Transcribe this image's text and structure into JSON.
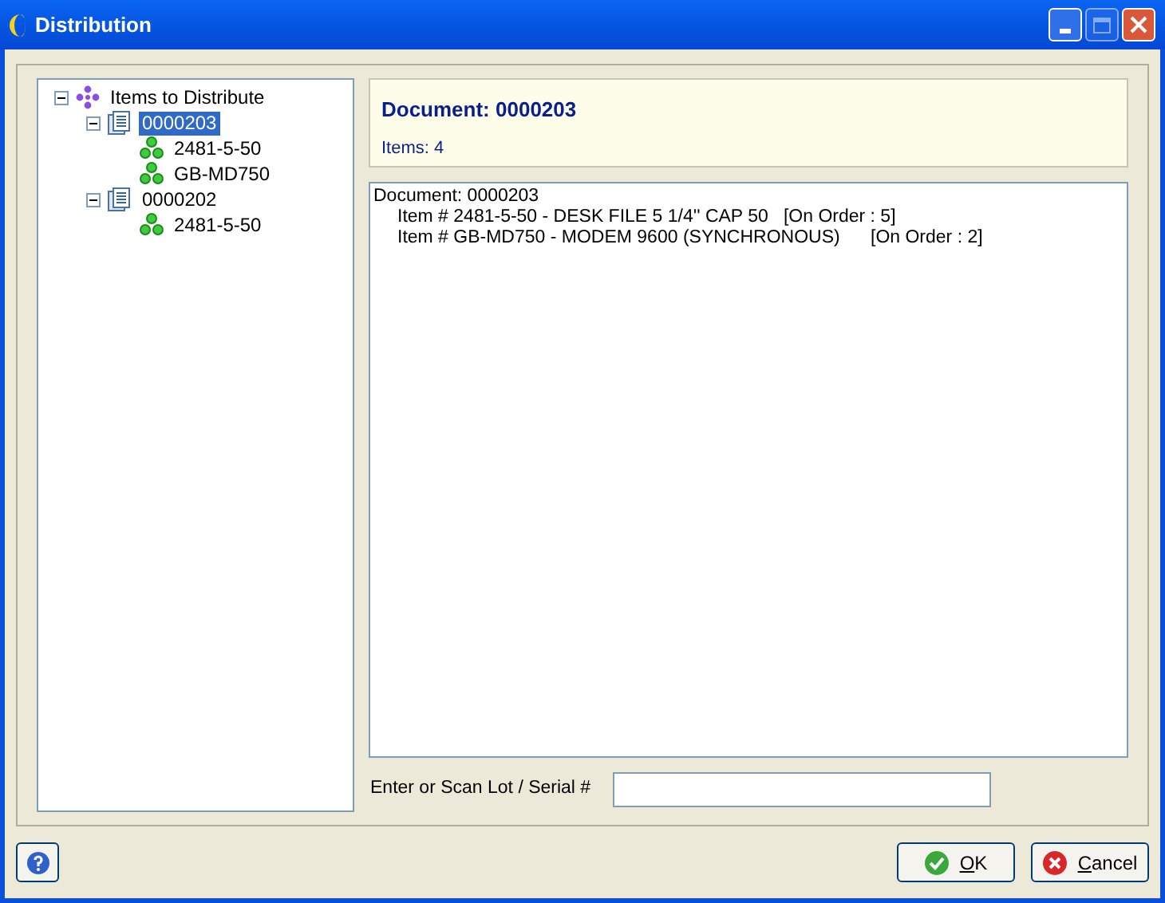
{
  "window": {
    "title": "Distribution",
    "controls": [
      {
        "kind": "minimize",
        "disabled": false
      },
      {
        "kind": "maximize",
        "disabled": true
      },
      {
        "kind": "close",
        "disabled": false
      }
    ]
  },
  "tree": {
    "label": "Items to Distribute",
    "expanded": true,
    "children": [
      {
        "label": "0000203",
        "expanded": true,
        "selected": true,
        "children": [
          {
            "label": "2481-5-50",
            "selected": false
          },
          {
            "label": "GB-MD750",
            "selected": false
          }
        ]
      },
      {
        "label": "0000202",
        "expanded": true,
        "selected": false,
        "children": [
          {
            "label": "2481-5-50",
            "selected": false
          }
        ]
      }
    ]
  },
  "header": {
    "title": "Document: 0000203",
    "subtitle": "Items: 4"
  },
  "details": {
    "text": "Document: 0000203",
    "children": [
      {
        "text": "Item # 2481-5-50 - DESK FILE 5 1/4'' CAP 50   [On Order : 5]"
      },
      {
        "text": "Item # GB-MD750 - MODEM 9600 (SYNCHRONOUS)      [On Order : 2]"
      }
    ]
  },
  "lot_field": {
    "label": "Enter or Scan Lot / Serial #"
  },
  "buttons": [
    {
      "kind": "ok",
      "label": "OK"
    },
    {
      "kind": "cancel",
      "label": "Cancel"
    }
  ]
}
